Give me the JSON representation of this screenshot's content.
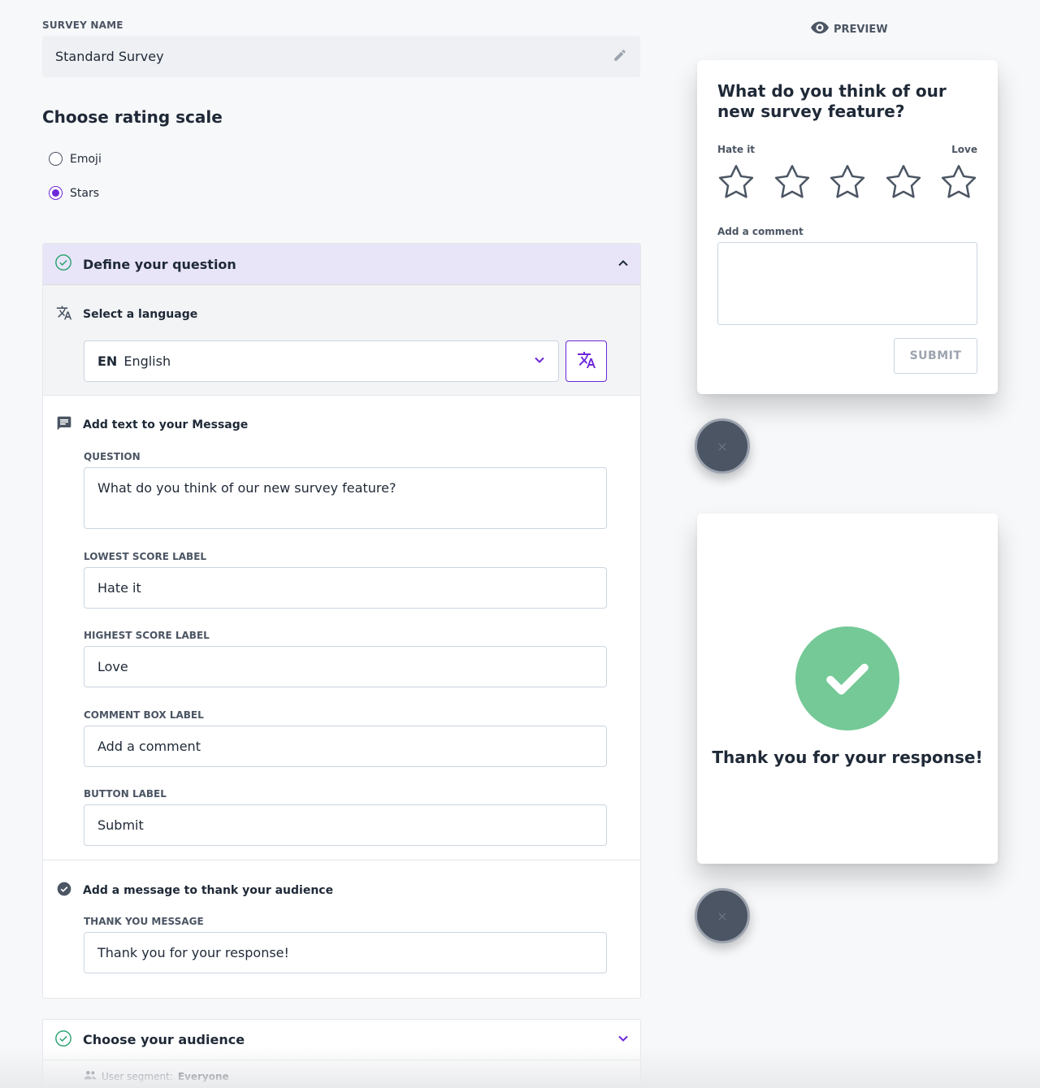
{
  "survey_name": {
    "label": "SURVEY NAME",
    "value": "Standard Survey",
    "edit_icon": "pencil-icon"
  },
  "rating_scale": {
    "title": "Choose rating scale",
    "options": [
      {
        "label": "Emoji",
        "selected": false
      },
      {
        "label": "Stars",
        "selected": true
      }
    ]
  },
  "define_question": {
    "title": "Define your question",
    "expanded": true,
    "language": {
      "title": "Select a language",
      "code": "EN",
      "name": "English"
    },
    "message": {
      "title": "Add text to your Message",
      "question_label": "QUESTION",
      "question_value": "What do you think of our new survey feature?",
      "lowest_label": "LOWEST SCORE LABEL",
      "lowest_value": "Hate it",
      "highest_label": "HIGHEST SCORE LABEL",
      "highest_value": "Love",
      "comment_label": "COMMENT BOX LABEL",
      "comment_value": "Add a comment",
      "button_label": "BUTTON LABEL",
      "button_value": "Submit"
    },
    "thanks": {
      "title": "Add a message to thank your audience",
      "label": "THANK YOU MESSAGE",
      "value": "Thank you for your response!"
    }
  },
  "audience": {
    "title": "Choose your audience",
    "segment_prefix": "User segment:",
    "segment_value": "Everyone"
  },
  "preview": {
    "label": "PREVIEW",
    "question": "What do you think of our new survey feature?",
    "low": "Hate it",
    "high": "Love",
    "star_count": 5,
    "comment_label": "Add a comment",
    "submit": "SUBMIT",
    "thanks": "Thank you for your response!",
    "close_glyph": "×"
  },
  "colors": {
    "accent": "#6d28d9",
    "header_bg": "#e8e5f8",
    "success": "#74c997",
    "close_bg": "#4b5563"
  }
}
